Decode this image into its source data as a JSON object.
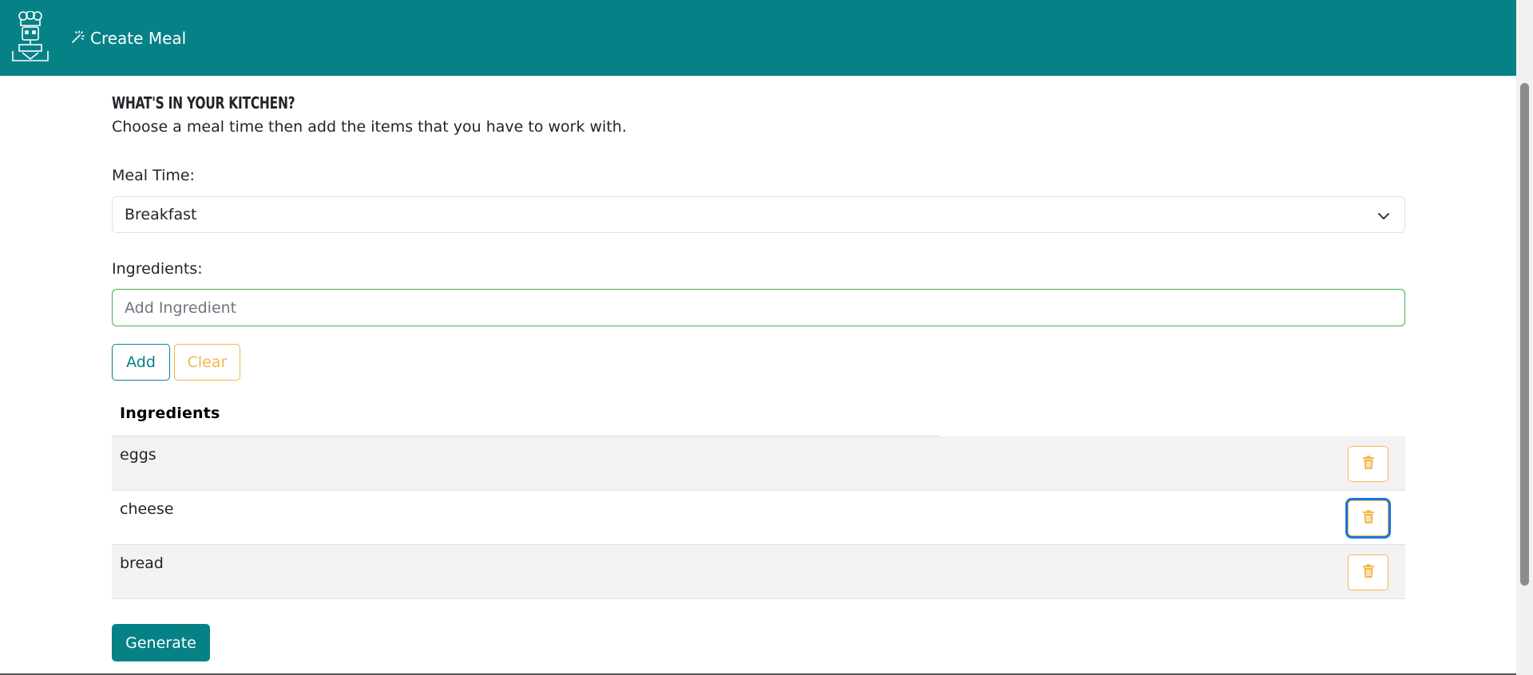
{
  "navbar": {
    "logo_icon": "chef-robot-logo",
    "create_meal_icon": "magic-wand-icon",
    "create_meal_label": "Create Meal",
    "color": "#068287"
  },
  "kitchen": {
    "heading": "What's in your kitchen?",
    "subheading": "Choose a meal time then add the items that you have to work with."
  },
  "meal_time": {
    "label": "Meal Time:",
    "selected": "Breakfast",
    "icon": "chevron-down-icon"
  },
  "ingredients_input": {
    "label": "Ingredients:",
    "placeholder": "Add Ingredient"
  },
  "buttons": {
    "add_label": "Add",
    "clear_label": "Clear",
    "generate_label": "Generate"
  },
  "table": {
    "header": "Ingredients",
    "rows": [
      {
        "name": "eggs"
      },
      {
        "name": "cheese"
      },
      {
        "name": "bread"
      }
    ],
    "delete_icon": "trash-icon"
  },
  "colors": {
    "accent": "#068287",
    "warning": "#f5b74a",
    "input_focus": "#3fb24f",
    "focus_ring": "#1a73e8"
  }
}
